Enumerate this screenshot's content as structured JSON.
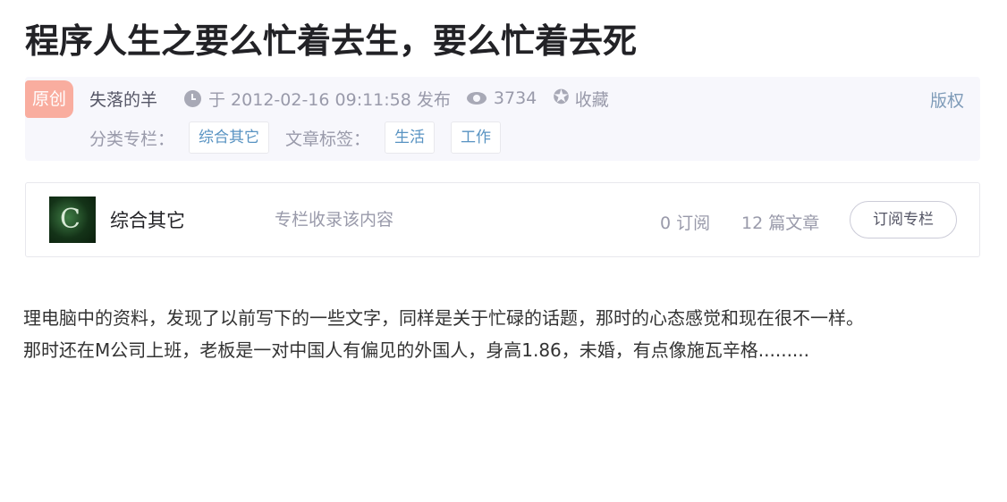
{
  "article": {
    "title": "程序人生之要么忙着去生，要么忙着去死"
  },
  "meta": {
    "badge": "原创",
    "author": "失落的羊",
    "publish_text": "于 2012-02-16 09:11:58 发布",
    "views": "3734",
    "favorite_label": "收藏",
    "copyright_label": "版权",
    "category_label": "分类专栏：",
    "categories": [
      "综合其它"
    ],
    "tags_label": "文章标签：",
    "tags": [
      "生活",
      "工作"
    ]
  },
  "column": {
    "name": "综合其它",
    "description": "专栏收录该内容",
    "subscribers": "0 订阅",
    "articles": "12 篇文章",
    "subscribe_button": "订阅专栏"
  },
  "content": {
    "paragraphs": [
      " 理电脑中的资料，发现了以前写下的一些文字，同样是关于忙碌的话题，那时的心态感觉和现在很不一样。",
      " 那时还在M公司上班，老板是一对中国人有偏见的外国人，身高1.86，未婚，有点像施瓦辛格........."
    ]
  },
  "colors": {
    "badge_bg": "#f9ad9f",
    "tag_text": "#5893c2",
    "meta_bg": "#f7f7fc",
    "muted_text": "#999aaa"
  },
  "icons": [
    "clock-icon",
    "eye-icon",
    "star-icon"
  ]
}
